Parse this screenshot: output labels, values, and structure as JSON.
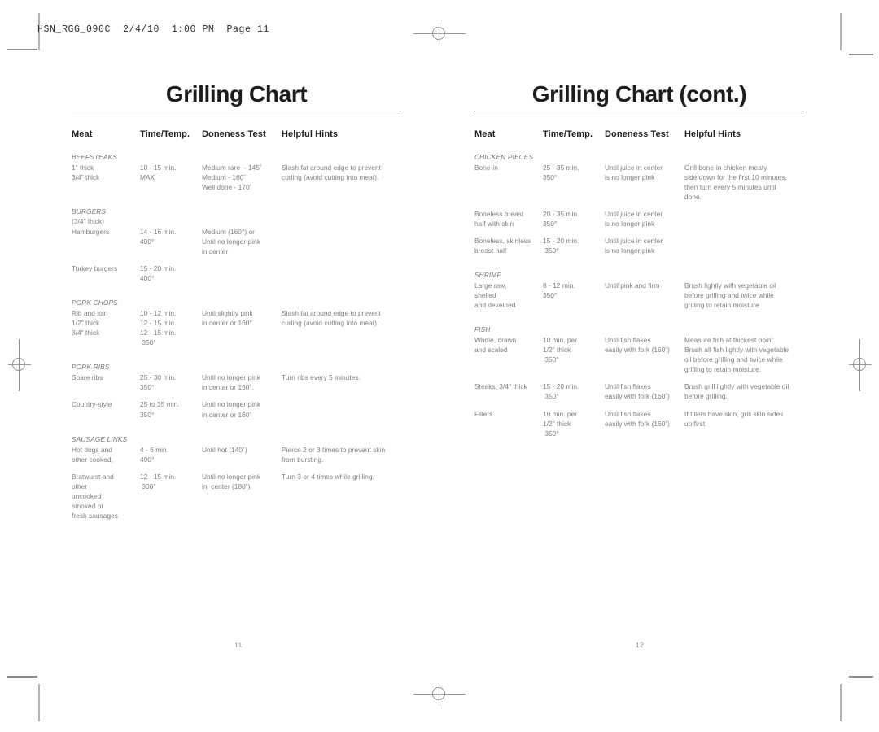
{
  "slug": "HSN_RGG_090C  2/4/10  1:00 PM  Page 11",
  "columns": [
    {
      "title": "Grilling Chart",
      "folio": "11",
      "headers": {
        "meat": "Meat",
        "time": "Time/Temp.",
        "doneness": "Doneness Test",
        "hints": "Helpful Hints"
      },
      "sections": [
        {
          "label": "BEEFSTEAKS",
          "rows": [
            {
              "meat": [
                "1\" thick",
                "3/4\" thick"
              ],
              "time": [
                "10 - 15 min.",
                "MAX"
              ],
              "doneness": [
                "Medium rare  - 145˚",
                "Medium - 160˚",
                "Well done - 170˚"
              ],
              "hints": [
                "Slash fat around edge to prevent",
                "curling (avoid cutting into meat)."
              ]
            }
          ]
        },
        {
          "label": "BURGERS",
          "sublabel": "(3/4\" thick)",
          "rows": [
            {
              "meat": [
                "Hamburgers"
              ],
              "time": [
                "14 - 16 min.",
                "400°"
              ],
              "doneness": [
                "Medium (160°) or",
                "Until no longer pink",
                "in center"
              ],
              "hints": []
            },
            {
              "meat": [
                "Turkey burgers"
              ],
              "time": [
                "15 - 20 min.",
                "400°"
              ],
              "doneness": [],
              "hints": []
            }
          ]
        },
        {
          "label": "PORK CHOPS",
          "rows": [
            {
              "meat": [
                "Rib and loin",
                "1/2\" thick",
                "3/4\" thick"
              ],
              "time": [
                "10 - 12 min.",
                "12 - 15 min.",
                "12 - 15 min.",
                " 350°"
              ],
              "doneness": [
                "Until slightly pink",
                "in center or 160°."
              ],
              "hints": [
                "Slash fat around edge to prevent",
                "curling (avoid cutting into meat)."
              ]
            }
          ]
        },
        {
          "label": "PORK RIBS",
          "rows": [
            {
              "meat": [
                "Spare ribs"
              ],
              "time": [
                "25 - 30 min.",
                "350°"
              ],
              "doneness": [
                "Until no longer pink",
                "in center or 160˚."
              ],
              "hints": [
                "Turn ribs every 5 minutes."
              ]
            },
            {
              "meat": [
                "Country-style"
              ],
              "time": [
                "25 to 35 min.",
                "350°"
              ],
              "doneness": [
                "Until no longer pink",
                "in center or 160˚"
              ],
              "hints": []
            }
          ]
        },
        {
          "label": "SAUSAGE LINKS",
          "rows": [
            {
              "meat": [
                "Hot dogs and",
                "other cooked,"
              ],
              "time": [
                "4 - 6 min.",
                "400°"
              ],
              "doneness": [
                "Until hot (140˚)"
              ],
              "hints": [
                "Pierce 2 or 3 times to prevent skin",
                "from bursting."
              ]
            },
            {
              "meat": [
                "Bratwurst and",
                "other",
                "uncooked",
                "smoked or",
                "fresh sausages"
              ],
              "time": [
                "12 - 15 min.",
                " 300°"
              ],
              "doneness": [
                "Until no longer pink",
                "in  center (180˚)"
              ],
              "hints": [
                "Turn 3 or 4 times while grilling."
              ]
            }
          ]
        }
      ]
    },
    {
      "title": "Grilling Chart (cont.)",
      "folio": "12",
      "headers": {
        "meat": "Meat",
        "time": "Time/Temp.",
        "doneness": "Doneness Test",
        "hints": "Helpful Hints"
      },
      "sections": [
        {
          "label": "CHICKEN PIECES",
          "rows": [
            {
              "meat": [
                "Bone-in"
              ],
              "time": [
                "25 - 35 min.",
                "350°"
              ],
              "doneness": [
                "Until juice in center",
                "is no longer pink"
              ],
              "hints": [
                "Grill bone-in chicken meaty",
                "side down for the first 10 minutes,",
                "then turn every 5 minutes until",
                "done."
              ]
            },
            {
              "meat": [
                "Boneless breast",
                "half with skin"
              ],
              "time": [
                "20 - 35 min.",
                "350°"
              ],
              "doneness": [
                "Until juice in center",
                "is no longer pink"
              ],
              "hints": []
            },
            {
              "meat": [
                "Boneless, skinless",
                "breast half"
              ],
              "time": [
                "15 - 20 min.",
                " 350°"
              ],
              "doneness": [
                "Until juice in center",
                "is no longer pink"
              ],
              "hints": []
            }
          ]
        },
        {
          "label": "SHRIMP",
          "rows": [
            {
              "meat": [
                "Large raw,",
                "shelled",
                "and deveined"
              ],
              "time": [
                "8 - 12 min.",
                "350°"
              ],
              "doneness": [
                "Until pink and firm"
              ],
              "hints": [
                "Brush lightly with vegetable oil",
                "before grilling and twice while",
                "grilling to retain moisture"
              ]
            }
          ]
        },
        {
          "label": "FISH",
          "rows": [
            {
              "meat": [
                "Whole, drawn",
                "and scaled"
              ],
              "time": [
                "10 min. per",
                "1/2\" thick",
                " 350°"
              ],
              "doneness": [
                "Until fish flakes",
                "easily with fork (160˚)"
              ],
              "hints": [
                "Measure fish at thickest point.",
                "Brush all fish lightly with vegetable",
                "oil before grilling and twice while",
                "grilling to retain moisture."
              ]
            },
            {
              "meat": [
                "Steaks, 3/4\" thick"
              ],
              "time": [
                "15 - 20 min.",
                " 350°"
              ],
              "doneness": [
                "Until fish flakes",
                "easily with fork (160˚)"
              ],
              "hints": [
                "Brush grill lightly with vegetable oil",
                "before grilling."
              ]
            },
            {
              "meat": [
                "Fillets"
              ],
              "time": [
                "10 min. per",
                "1/2\" thick",
                " 350°"
              ],
              "doneness": [
                "Until fish flakes",
                "easily with fork (160˚)"
              ],
              "hints": [
                "If fillets have skin, grill skin sides",
                "up first."
              ]
            }
          ]
        }
      ]
    }
  ]
}
